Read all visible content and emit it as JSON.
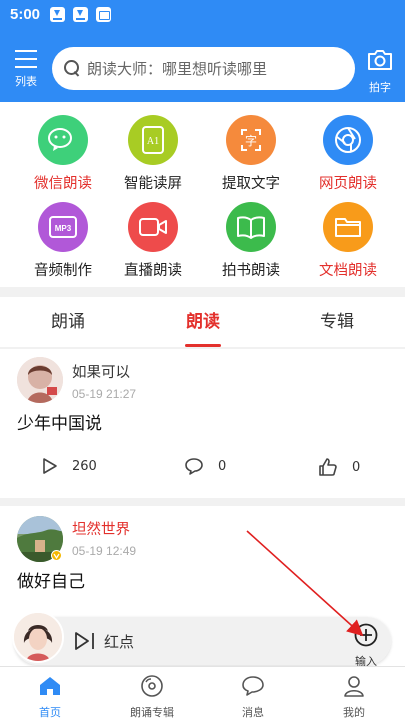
{
  "status_bar": {
    "time": "5:00"
  },
  "header": {
    "menu_label": "列表",
    "search_placeholder": "朗读大师：哪里想听读哪里",
    "camera_label": "拍字"
  },
  "features": [
    {
      "label": "微信朗读",
      "icon": "wechat-icon",
      "color": "#3ed07a",
      "label_color": "red"
    },
    {
      "label": "智能读屏",
      "icon": "ai-screen-icon",
      "color": "#a8cc24",
      "label_color": "normal"
    },
    {
      "label": "提取文字",
      "icon": "extract-text-icon",
      "color": "#f58a3c",
      "label_color": "normal"
    },
    {
      "label": "网页朗读",
      "icon": "browser-icon",
      "color": "#2f8bf5",
      "label_color": "red"
    },
    {
      "label": "音频制作",
      "icon": "mp3-icon",
      "color": "#b158d8",
      "label_color": "normal"
    },
    {
      "label": "直播朗读",
      "icon": "video-camera-icon",
      "color": "#ee4b4b",
      "label_color": "normal"
    },
    {
      "label": "拍书朗读",
      "icon": "open-book-icon",
      "color": "#3cbb4c",
      "label_color": "normal"
    },
    {
      "label": "文档朗读",
      "icon": "folder-icon",
      "color": "#f89b1a",
      "label_color": "red"
    }
  ],
  "tabs": [
    {
      "label": "朗诵",
      "active": false
    },
    {
      "label": "朗读",
      "active": true
    },
    {
      "label": "专辑",
      "active": false
    }
  ],
  "posts": [
    {
      "user": "如果可以",
      "time": "05-19 21:27",
      "title": "少年中国说",
      "plays": "260",
      "comments": "0",
      "likes": "0"
    },
    {
      "user": "坦然世界",
      "time": "05-19 12:49",
      "title": "做好自己"
    }
  ],
  "player": {
    "track": "红点",
    "add_label": "输入"
  },
  "bottom_nav": [
    {
      "label": "首页",
      "icon": "home-icon",
      "active": true
    },
    {
      "label": "朗诵专辑",
      "icon": "disc-icon",
      "active": false
    },
    {
      "label": "消息",
      "icon": "message-icon",
      "active": false
    },
    {
      "label": "我的",
      "icon": "profile-icon",
      "active": false
    }
  ],
  "colors": {
    "accent": "#2f8bf5",
    "highlight": "#e3302c",
    "annotation": "#e02020"
  }
}
